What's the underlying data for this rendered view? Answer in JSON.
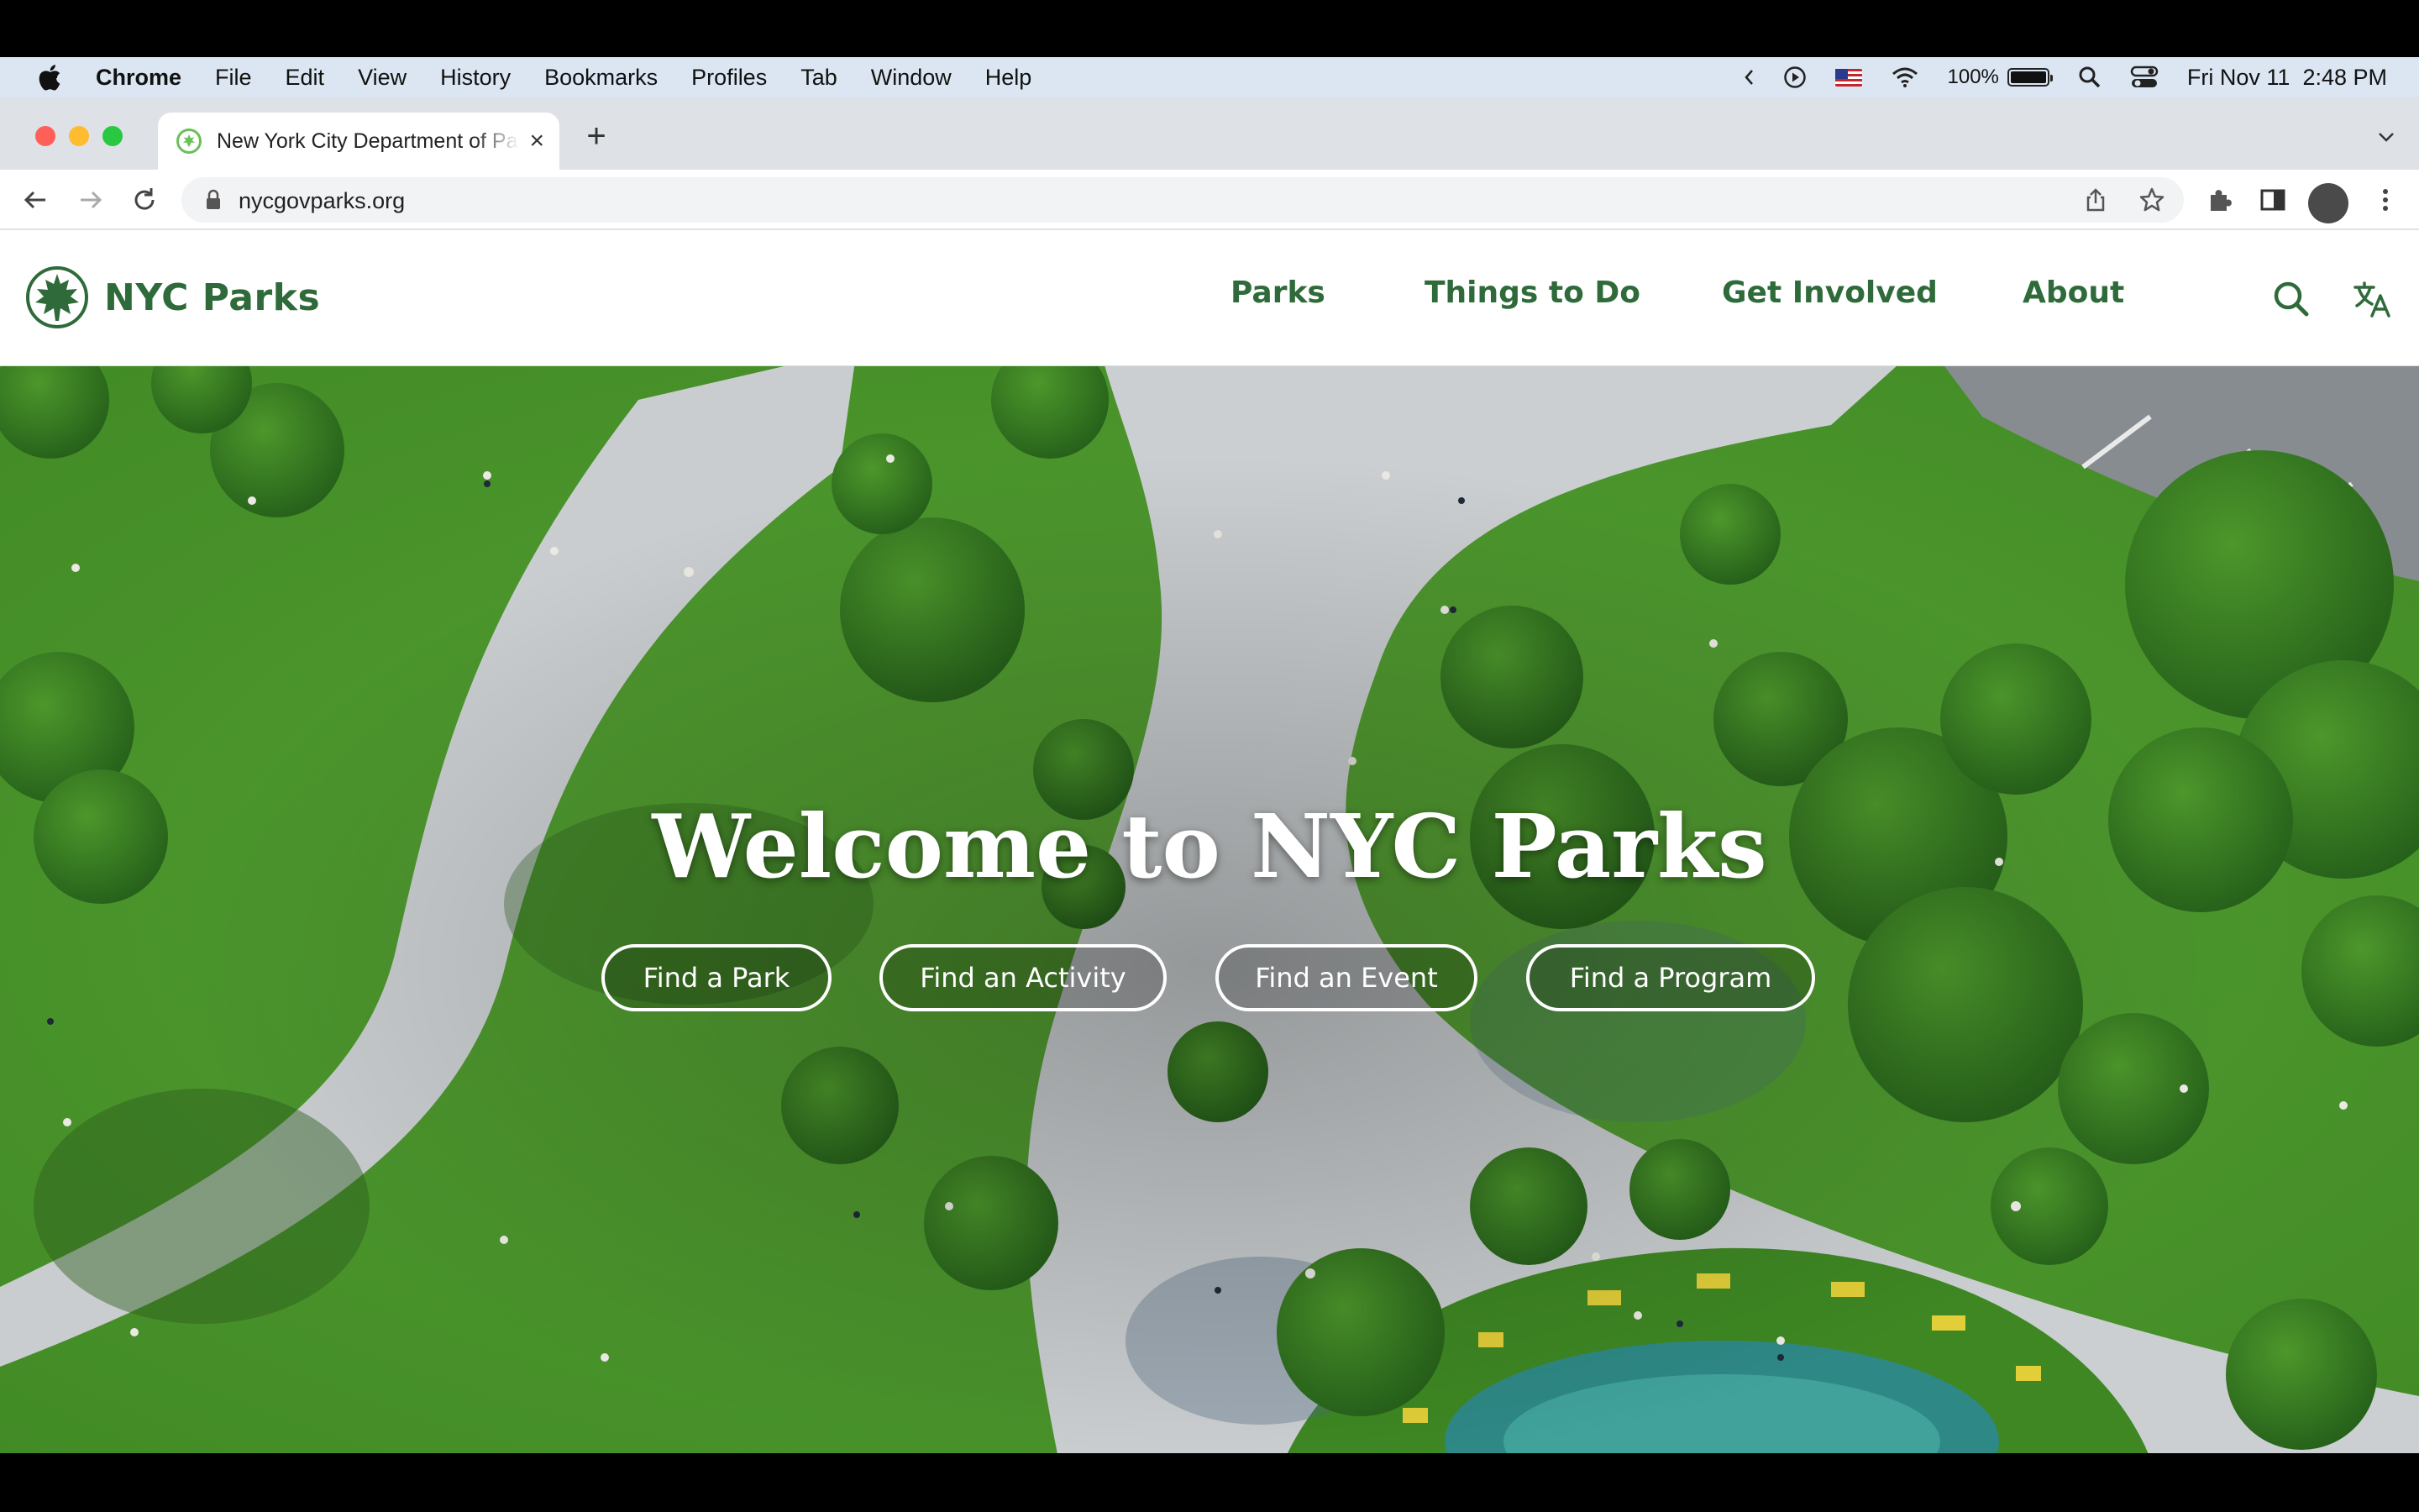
{
  "menubar": {
    "app": "Chrome",
    "items": [
      "File",
      "Edit",
      "View",
      "History",
      "Bookmarks",
      "Profiles",
      "Tab",
      "Window",
      "Help"
    ],
    "battery": "100%",
    "datetime": "Fri Nov 11  2:48 PM"
  },
  "browser": {
    "tab_title": "New York City Department of Parks & Recreation",
    "url": "nycgovparks.org"
  },
  "site": {
    "logo_text": "NYC Parks",
    "nav": [
      "Parks",
      "Things to Do",
      "Get Involved",
      "About"
    ],
    "hero_title": "Welcome to NYC Parks",
    "hero_buttons": [
      "Find a Park",
      "Find an Activity",
      "Find an Event",
      "Find a Program"
    ]
  },
  "colors": {
    "brand_green": "#2f6b3a",
    "grass": "#4f9a2e",
    "path": "#cfd3d5"
  }
}
